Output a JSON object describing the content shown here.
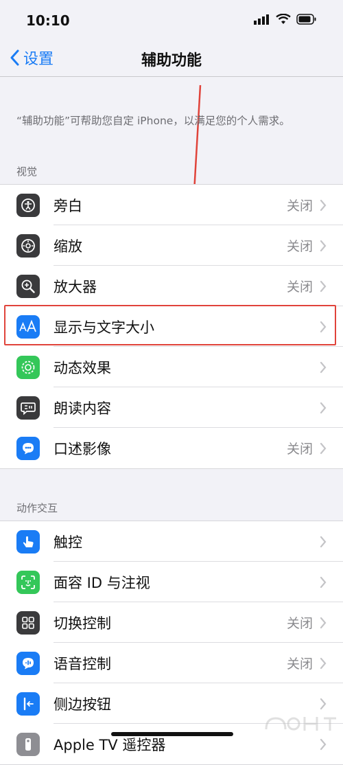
{
  "status_bar": {
    "time": "10:10"
  },
  "nav": {
    "back_label": "设置",
    "title": "辅助功能"
  },
  "description": "“辅助功能”可帮助您自定 iPhone，以满足您的个人需求。",
  "sections": {
    "vision": {
      "header": "视觉",
      "items": [
        {
          "label": "旁白",
          "value": "关闭",
          "icon": "voiceover-icon",
          "color": "#3a3a3c"
        },
        {
          "label": "缩放",
          "value": "关闭",
          "icon": "zoom-icon",
          "color": "#3a3a3c"
        },
        {
          "label": "放大器",
          "value": "关闭",
          "icon": "magnifier-icon",
          "color": "#3a3a3c"
        },
        {
          "label": "显示与文字大小",
          "value": "",
          "icon": "text-size-icon",
          "color": "#1a7cf5"
        },
        {
          "label": "动态效果",
          "value": "",
          "icon": "motion-icon",
          "color": "#34c759"
        },
        {
          "label": "朗读内容",
          "value": "",
          "icon": "spoken-content-icon",
          "color": "#3a3a3c"
        },
        {
          "label": "口述影像",
          "value": "关闭",
          "icon": "audio-description-icon",
          "color": "#1a7cf5"
        }
      ]
    },
    "interaction": {
      "header": "动作交互",
      "items": [
        {
          "label": "触控",
          "value": "",
          "icon": "touch-icon",
          "color": "#1a7cf5"
        },
        {
          "label": "面容 ID 与注视",
          "value": "",
          "icon": "face-id-icon",
          "color": "#34c759"
        },
        {
          "label": "切换控制",
          "value": "关闭",
          "icon": "switch-control-icon",
          "color": "#3a3a3c"
        },
        {
          "label": "语音控制",
          "value": "关闭",
          "icon": "voice-control-icon",
          "color": "#1a7cf5"
        },
        {
          "label": "侧边按钮",
          "value": "",
          "icon": "side-button-icon",
          "color": "#1a7cf5"
        },
        {
          "label": "Apple TV 遥控器",
          "value": "",
          "icon": "apple-tv-remote-icon",
          "color": "#8e8e93"
        }
      ]
    }
  },
  "colors": {
    "accent": "#1a7cf5",
    "annotation": "#e0433a"
  }
}
